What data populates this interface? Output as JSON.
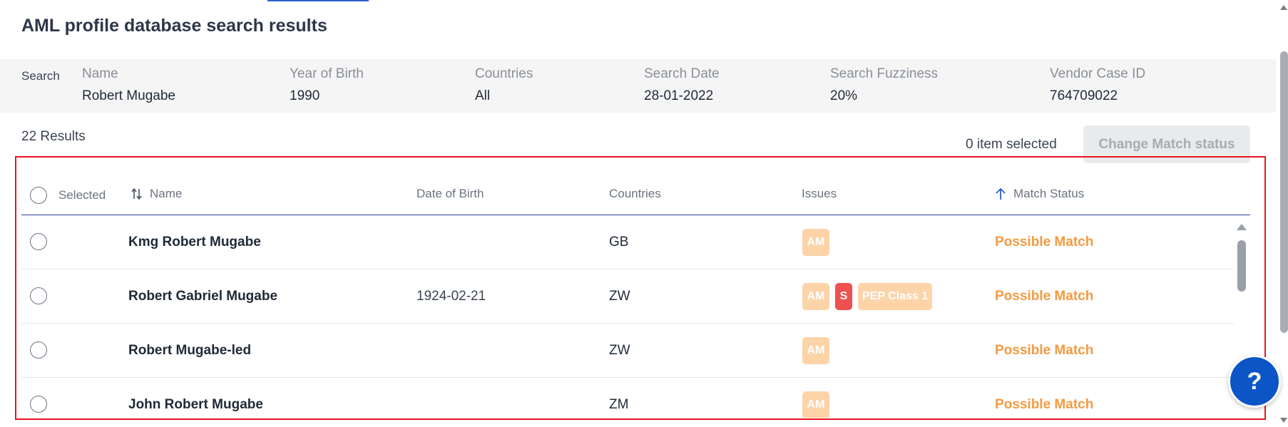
{
  "page": {
    "title": "AML profile database search results"
  },
  "search": {
    "label": "Search",
    "fields": [
      {
        "label": "Name",
        "value": "Robert Mugabe"
      },
      {
        "label": "Year of Birth",
        "value": "1990"
      },
      {
        "label": "Countries",
        "value": "All"
      },
      {
        "label": "Search Date",
        "value": "28-01-2022"
      },
      {
        "label": "Search Fuzziness",
        "value": "20%"
      },
      {
        "label": "Vendor Case ID",
        "value": "764709022"
      }
    ]
  },
  "results": {
    "count_label": "22 Results",
    "selected_label": "0 item selected",
    "change_button": "Change Match status"
  },
  "table": {
    "headers": {
      "selected": "Selected",
      "name": "Name",
      "dob": "Date of Birth",
      "countries": "Countries",
      "issues": "Issues",
      "match_status": "Match Status"
    },
    "rows": [
      {
        "name": "Kmg Robert Mugabe",
        "dob": "",
        "country": "GB",
        "issues": [
          "AM"
        ],
        "status": "Possible Match"
      },
      {
        "name": "Robert Gabriel Mugabe",
        "dob": "1924-02-21",
        "country": "ZW",
        "issues": [
          "AM",
          "S",
          "PEP Class 1"
        ],
        "status": "Possible Match"
      },
      {
        "name": "Robert Mugabe-led",
        "dob": "",
        "country": "ZW",
        "issues": [
          "AM"
        ],
        "status": "Possible Match"
      },
      {
        "name": "John Robert Mugabe",
        "dob": "",
        "country": "ZM",
        "issues": [
          "AM"
        ],
        "status": "Possible Match"
      }
    ]
  },
  "help": {
    "label": "?"
  },
  "colors": {
    "accent": "#2f5fd0",
    "status_orange": "#f59a40",
    "badge_amber": "#fdd3a8",
    "badge_red": "#ef5050",
    "highlight_frame": "#e8141c",
    "help_button": "#0b55c7"
  },
  "icons": {
    "sort_name": "sort-arrows-icon",
    "sort_status": "arrow-up-icon"
  }
}
